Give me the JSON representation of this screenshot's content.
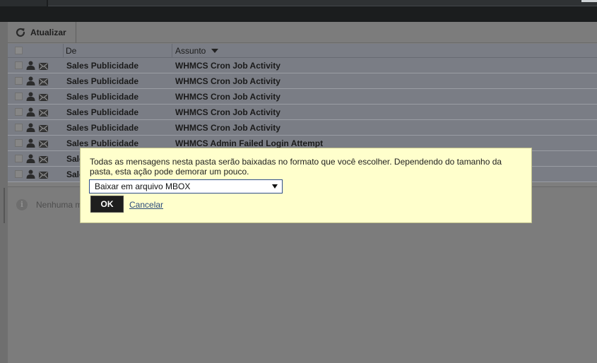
{
  "toolbar": {
    "refresh_label": "Atualizar"
  },
  "list": {
    "columns": {
      "from": "De",
      "subject": "Assunto"
    },
    "rows": [
      {
        "from": "Sales Publicidade",
        "subject": "WHMCS Cron Job Activity"
      },
      {
        "from": "Sales Publicidade",
        "subject": "WHMCS Cron Job Activity"
      },
      {
        "from": "Sales Publicidade",
        "subject": "WHMCS Cron Job Activity"
      },
      {
        "from": "Sales Publicidade",
        "subject": "WHMCS Cron Job Activity"
      },
      {
        "from": "Sales Publicidade",
        "subject": "WHMCS Cron Job Activity"
      },
      {
        "from": "Sales Publicidade",
        "subject": "WHMCS Admin Failed Login Attempt"
      },
      {
        "from": "Sale",
        "subject": ""
      },
      {
        "from": "Sale",
        "subject": ""
      }
    ]
  },
  "preview": {
    "message": "Nenhuma m"
  },
  "dialog": {
    "message": "Todas as mensagens nesta pasta serão baixadas no formato que você escolher. Dependendo do tamanho da pasta, esta ação pode demorar um pouco.",
    "format_selected": "Baixar em arquivo MBOX",
    "ok_label": "OK",
    "cancel_label": "Cancelar"
  },
  "colors": {
    "dialog_bg": "#ffffcc",
    "overlay": "#7e7e7e",
    "topbar": "#1b1d1e",
    "select_border": "#2f4e8a"
  }
}
